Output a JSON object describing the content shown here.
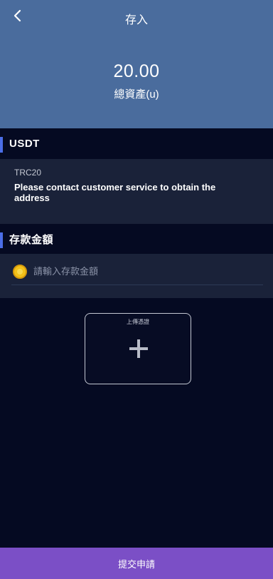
{
  "header": {
    "title": "存入",
    "back_icon": "chevron-left-icon",
    "balance": "20.00",
    "balance_label": "總資產(u)"
  },
  "currency_section": {
    "heading": "USDT",
    "network": "TRC20",
    "address_text": "Please contact customer service to obtain the address"
  },
  "amount_section": {
    "heading": "存款金額",
    "icon": "coin-icon",
    "placeholder": "請輸入存款金額",
    "value": ""
  },
  "upload": {
    "label": "上傳憑證",
    "icon": "plus-icon"
  },
  "submit": {
    "label": "提交申請"
  },
  "colors": {
    "header_bg": "#4a6c9d",
    "page_bg": "#050a22",
    "card_bg": "#1a2239",
    "accent_bar": "#4b6ee8",
    "submit_bg": "#7b4fc6",
    "coin": "#f3c21a"
  }
}
